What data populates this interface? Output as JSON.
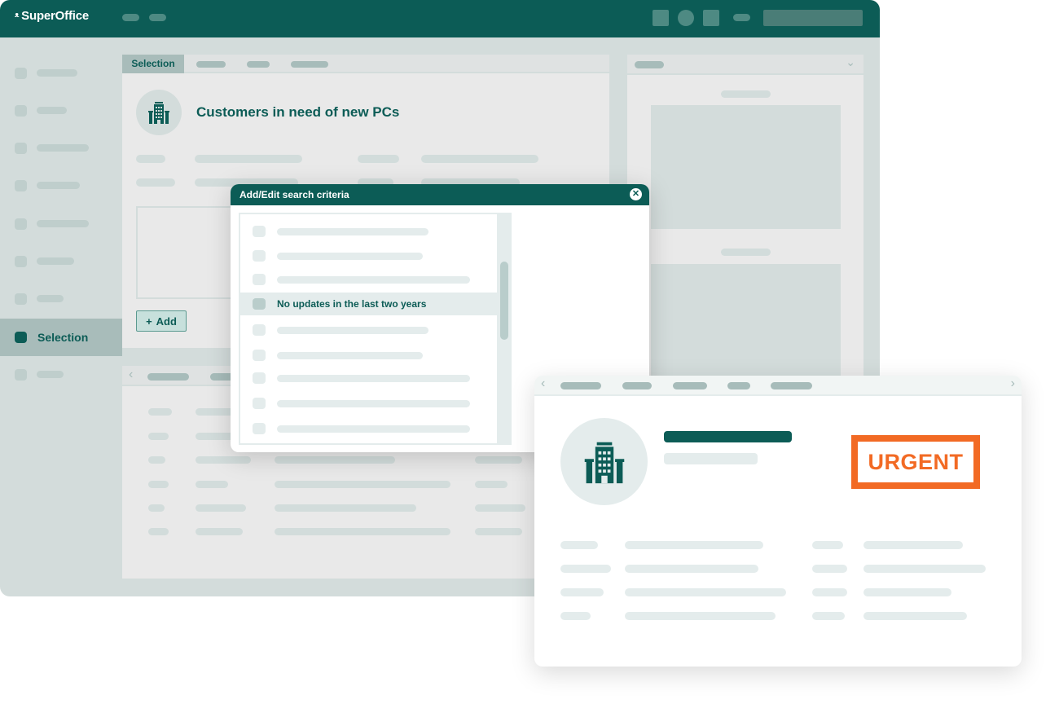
{
  "app": {
    "brand": "SuperOffice",
    "colors": {
      "primary": "#0c5c56",
      "accent": "#f26a24"
    }
  },
  "sidebar": {
    "active_label": "Selection"
  },
  "main": {
    "active_tab": "Selection",
    "title": "Customers in need of new PCs",
    "add_label": "Add",
    "add_icon": "plus-icon"
  },
  "dialog": {
    "title": "Add/Edit search criteria",
    "close_icon": "close-icon",
    "selected_criterion": "No updates in the last two years"
  },
  "card": {
    "badge": "URGENT"
  },
  "icons": {
    "building": "building-icon",
    "chevron_down": "chevron-down-icon",
    "chevron_left": "chevron-left-icon",
    "chevron_right": "chevron-right-icon"
  }
}
